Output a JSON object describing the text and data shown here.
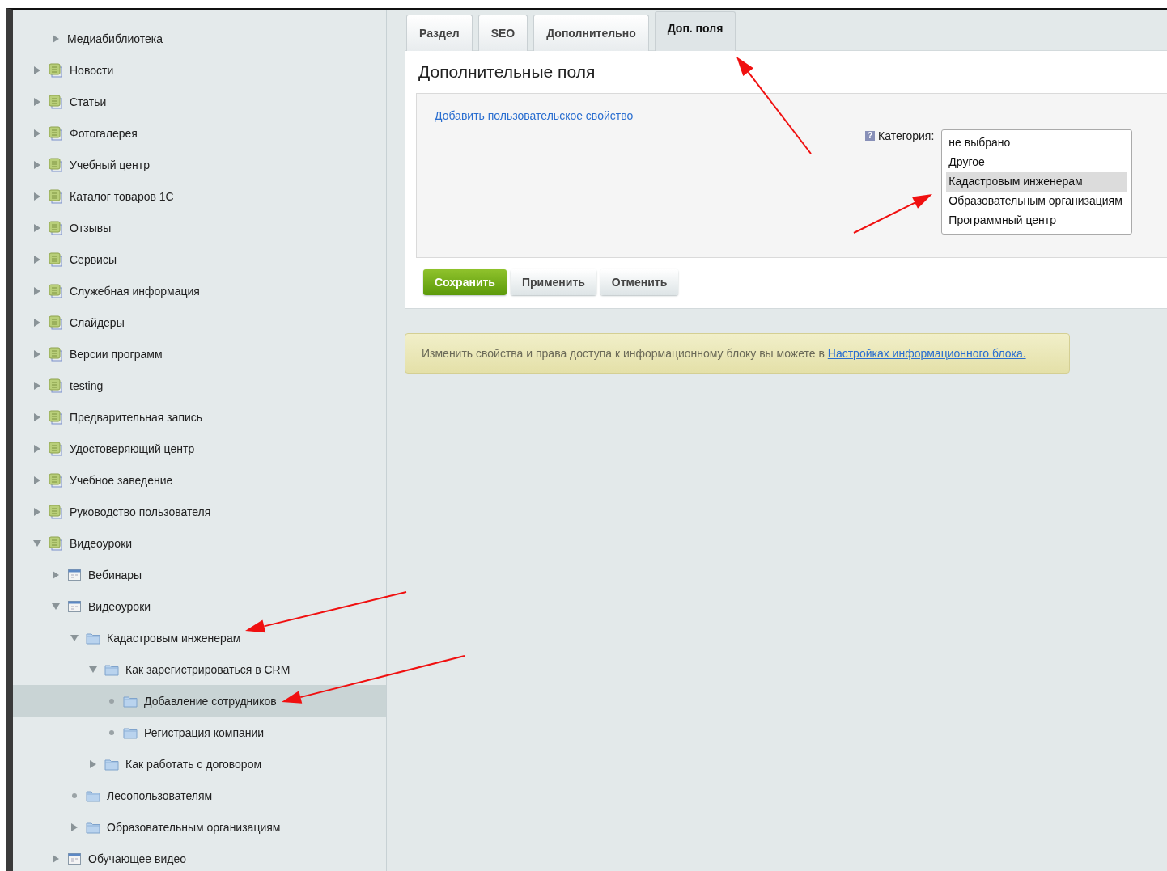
{
  "sidebar": {
    "tree": [
      {
        "label": "Медиабиблиотека",
        "kind": "plain",
        "has_children": true,
        "expanded": false,
        "selected": false
      },
      {
        "label": "Новости",
        "kind": "iblock",
        "has_children": true,
        "expanded": false,
        "selected": false
      },
      {
        "label": "Статьи",
        "kind": "iblock",
        "has_children": true,
        "expanded": false,
        "selected": false
      },
      {
        "label": "Фотогалерея",
        "kind": "iblock",
        "has_children": true,
        "expanded": false,
        "selected": false
      },
      {
        "label": "Учебный центр",
        "kind": "iblock",
        "has_children": true,
        "expanded": false,
        "selected": false
      },
      {
        "label": "Каталог товаров 1С",
        "kind": "iblock",
        "has_children": true,
        "expanded": false,
        "selected": false
      },
      {
        "label": "Отзывы",
        "kind": "iblock",
        "has_children": true,
        "expanded": false,
        "selected": false
      },
      {
        "label": "Сервисы",
        "kind": "iblock",
        "has_children": true,
        "expanded": false,
        "selected": false
      },
      {
        "label": "Служебная информация",
        "kind": "iblock",
        "has_children": true,
        "expanded": false,
        "selected": false
      },
      {
        "label": "Слайдеры",
        "kind": "iblock",
        "has_children": true,
        "expanded": false,
        "selected": false
      },
      {
        "label": "Версии программ",
        "kind": "iblock",
        "has_children": true,
        "expanded": false,
        "selected": false
      },
      {
        "label": "testing",
        "kind": "iblock",
        "has_children": true,
        "expanded": false,
        "selected": false
      },
      {
        "label": "Предварительная запись",
        "kind": "iblock",
        "has_children": true,
        "expanded": false,
        "selected": false
      },
      {
        "label": "Удостоверяющий центр",
        "kind": "iblock",
        "has_children": true,
        "expanded": false,
        "selected": false
      },
      {
        "label": "Учебное заведение",
        "kind": "iblock",
        "has_children": true,
        "expanded": false,
        "selected": false
      },
      {
        "label": "Руководство пользователя",
        "kind": "iblock",
        "has_children": true,
        "expanded": false,
        "selected": false
      },
      {
        "label": "Видеоуроки",
        "kind": "iblock",
        "has_children": true,
        "expanded": true,
        "selected": false,
        "children": [
          {
            "label": "Вебинары",
            "kind": "type",
            "has_children": true,
            "expanded": false,
            "selected": false
          },
          {
            "label": "Видеоуроки",
            "kind": "type",
            "has_children": true,
            "expanded": true,
            "selected": false,
            "children": [
              {
                "label": "Кадастровым инженерам",
                "kind": "folder",
                "has_children": true,
                "expanded": true,
                "selected": false,
                "children": [
                  {
                    "label": "Как зарегистрироваться в CRM",
                    "kind": "folder",
                    "has_children": true,
                    "expanded": true,
                    "selected": false,
                    "children": [
                      {
                        "label": "Добавление сотрудников",
                        "kind": "folder",
                        "has_children": false,
                        "expanded": false,
                        "selected": true
                      },
                      {
                        "label": "Регистрация компании",
                        "kind": "folder",
                        "has_children": false,
                        "expanded": false,
                        "selected": false
                      }
                    ]
                  },
                  {
                    "label": "Как работать с договором",
                    "kind": "folder",
                    "has_children": true,
                    "expanded": false,
                    "selected": false
                  }
                ]
              },
              {
                "label": "Лесопользователям",
                "kind": "folder",
                "has_children": false,
                "expanded": false,
                "selected": false
              },
              {
                "label": "Образовательным организациям",
                "kind": "folder",
                "has_children": true,
                "expanded": false,
                "selected": false
              }
            ]
          },
          {
            "label": "Обучающее видео",
            "kind": "type",
            "has_children": true,
            "expanded": false,
            "selected": false
          }
        ]
      }
    ]
  },
  "tabs": [
    {
      "label": "Раздел",
      "selected": false
    },
    {
      "label": "SEO",
      "selected": false
    },
    {
      "label": "Дополнительно",
      "selected": false
    },
    {
      "label": "Доп. поля",
      "selected": true
    }
  ],
  "panel": {
    "title": "Дополнительные поля",
    "add_link": "Добавить пользовательское свойство",
    "category": {
      "help": "?",
      "label": "Категория:",
      "options": [
        {
          "label": "не выбрано",
          "selected": false
        },
        {
          "label": "Другое",
          "selected": false
        },
        {
          "label": "Кадастровым инженерам",
          "selected": true
        },
        {
          "label": "Образовательным организациям",
          "selected": false
        },
        {
          "label": "Программный центр",
          "selected": false
        }
      ]
    },
    "buttons": [
      {
        "label": "Сохранить",
        "kind": "primary"
      },
      {
        "label": "Применить",
        "kind": "secondary"
      },
      {
        "label": "Отменить",
        "kind": "secondary"
      }
    ]
  },
  "notice": {
    "text": "Изменить свойства и права доступа к информационному блоку вы можете в",
    "link": "Настройках информационного блока."
  }
}
